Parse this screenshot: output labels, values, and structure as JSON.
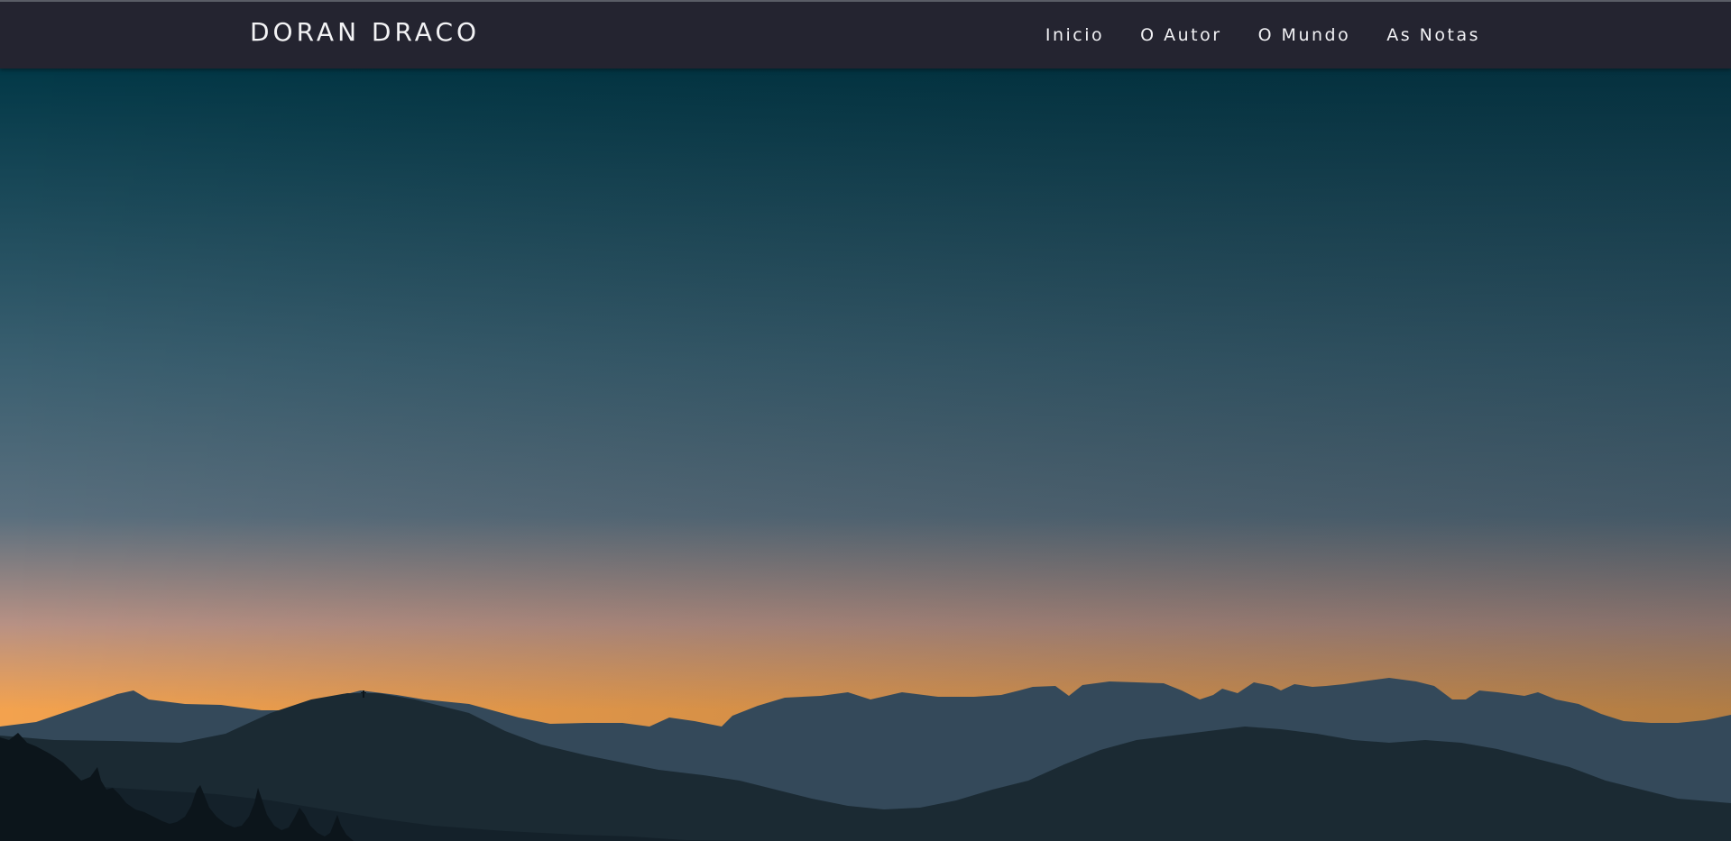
{
  "site": {
    "brand": "DORAN DRACO"
  },
  "nav": {
    "items": [
      {
        "label": "Inicio"
      },
      {
        "label": "O Autor"
      },
      {
        "label": "O Mundo"
      },
      {
        "label": "As Notas"
      }
    ]
  },
  "hero": {
    "image_subject": "mountain-sunset-landscape",
    "colors": {
      "sky_top": "#023847",
      "sky_mid": "#5a6f7e",
      "sky_pink": "#b89184",
      "sky_orange": "#f3a24e",
      "far_mountains": "#34495a",
      "near_mountains": "#1b2a33",
      "trees": "#0c151b"
    }
  },
  "theme": {
    "navbar_bg": "#242430",
    "nav_text": "#f1f1f4"
  }
}
